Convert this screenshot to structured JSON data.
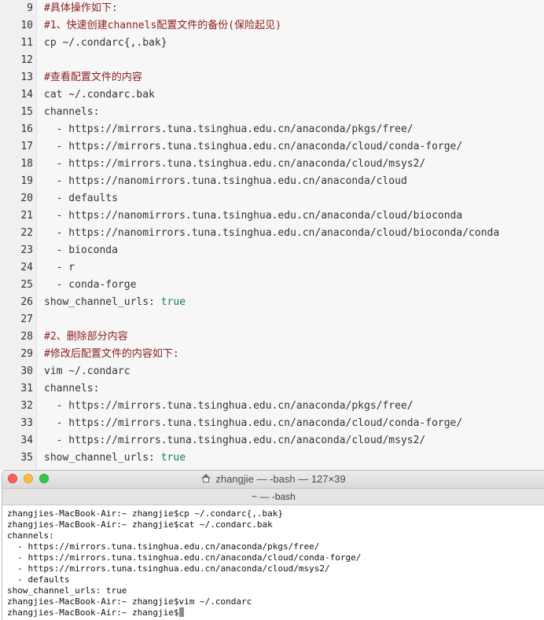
{
  "editor": {
    "lines": [
      {
        "num": "9",
        "text": "#具体操作如下:",
        "type": "comment"
      },
      {
        "num": "10",
        "text": "#1、快速创建channels配置文件的备份(保险起见)",
        "type": "comment"
      },
      {
        "num": "11",
        "text": "cp ~/.condarc{,.bak}",
        "type": "code"
      },
      {
        "num": "12",
        "text": "",
        "type": "code"
      },
      {
        "num": "13",
        "text": "#查看配置文件的内容",
        "type": "comment"
      },
      {
        "num": "14",
        "text": "cat ~/.condarc.bak",
        "type": "code"
      },
      {
        "num": "15",
        "text": "channels:",
        "type": "code"
      },
      {
        "num": "16",
        "text": "  - https://mirrors.tuna.tsinghua.edu.cn/anaconda/pkgs/free/",
        "type": "code"
      },
      {
        "num": "17",
        "text": "  - https://mirrors.tuna.tsinghua.edu.cn/anaconda/cloud/conda-forge/",
        "type": "code"
      },
      {
        "num": "18",
        "text": "  - https://mirrors.tuna.tsinghua.edu.cn/anaconda/cloud/msys2/",
        "type": "code"
      },
      {
        "num": "19",
        "text": "  - https://nanomirrors.tuna.tsinghua.edu.cn/anaconda/cloud",
        "type": "code"
      },
      {
        "num": "20",
        "text": "  - defaults",
        "type": "code"
      },
      {
        "num": "21",
        "text": "  - https://nanomirrors.tuna.tsinghua.edu.cn/anaconda/cloud/bioconda",
        "type": "code"
      },
      {
        "num": "22",
        "text": "  - https://nanomirrors.tuna.tsinghua.edu.cn/anaconda/cloud/bioconda/conda",
        "type": "code"
      },
      {
        "num": "23",
        "text": "  - bioconda",
        "type": "code"
      },
      {
        "num": "24",
        "text": "  - r",
        "type": "code"
      },
      {
        "num": "25",
        "text": "  - conda-forge",
        "type": "code"
      },
      {
        "num": "26",
        "text": "show_channel_urls: ",
        "keyword": "true",
        "type": "code"
      },
      {
        "num": "27",
        "text": "",
        "type": "code"
      },
      {
        "num": "28",
        "text": "#2、删除部分内容",
        "type": "comment"
      },
      {
        "num": "29",
        "text": "#修改后配置文件的内容如下:",
        "type": "comment"
      },
      {
        "num": "30",
        "text": "vim ~/.condarc",
        "type": "code"
      },
      {
        "num": "31",
        "text": "channels:",
        "type": "code"
      },
      {
        "num": "32",
        "text": "  - https://mirrors.tuna.tsinghua.edu.cn/anaconda/pkgs/free/",
        "type": "code"
      },
      {
        "num": "33",
        "text": "  - https://mirrors.tuna.tsinghua.edu.cn/anaconda/cloud/conda-forge/",
        "type": "code"
      },
      {
        "num": "34",
        "text": "  - https://mirrors.tuna.tsinghua.edu.cn/anaconda/cloud/msys2/",
        "type": "code"
      },
      {
        "num": "35",
        "text": "show_channel_urls: ",
        "keyword": "true",
        "type": "code"
      }
    ]
  },
  "terminal": {
    "title": "zhangjie — -bash — 127×39",
    "tab_label": "~ — -bash",
    "home_icon": "home-icon",
    "lines": [
      "zhangjies-MacBook-Air:~ zhangjie$cp ~/.condarc{,.bak}",
      "zhangjies-MacBook-Air:~ zhangjie$cat ~/.condarc.bak",
      "channels:",
      "  - https://mirrors.tuna.tsinghua.edu.cn/anaconda/pkgs/free/",
      "  - https://mirrors.tuna.tsinghua.edu.cn/anaconda/cloud/conda-forge/",
      "  - https://mirrors.tuna.tsinghua.edu.cn/anaconda/cloud/msys2/",
      "  - defaults",
      "show_channel_urls: true",
      "zhangjies-MacBook-Air:~ zhangjie$vim ~/.condarc"
    ],
    "prompt": "zhangjies-MacBook-Air:~ zhangjie$"
  },
  "colors": {
    "comment": "#8b1f1f",
    "keyword": "#0f7a6a",
    "close": "#fc605c",
    "minimize": "#fdbc40",
    "maximize": "#34c84a"
  }
}
